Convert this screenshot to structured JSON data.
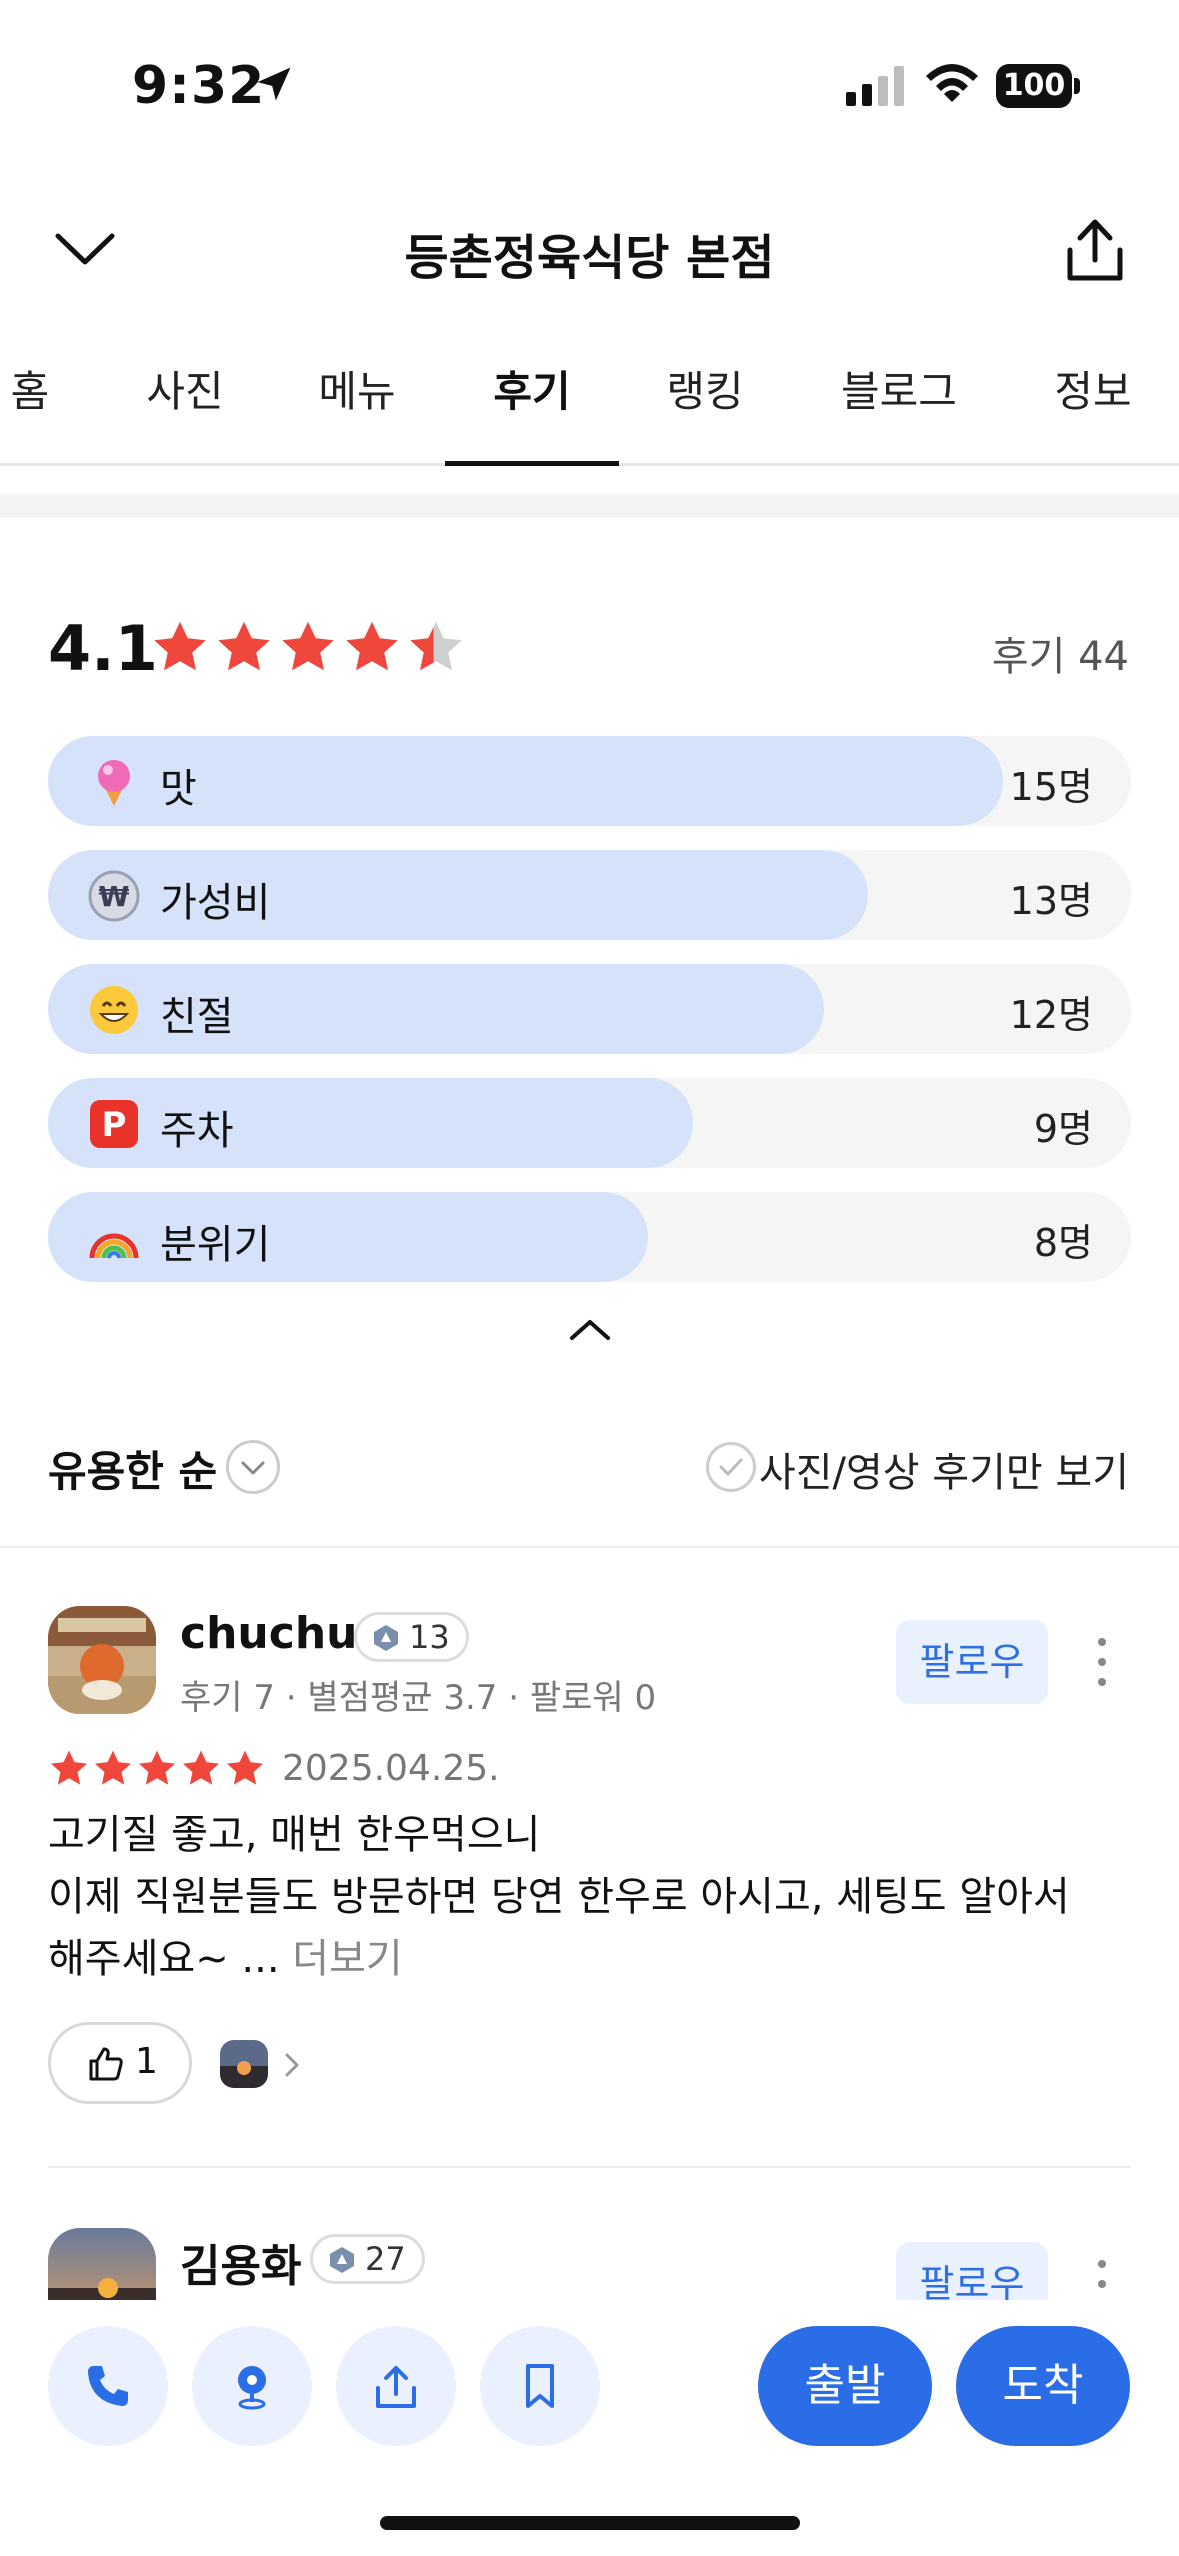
{
  "status_bar": {
    "time": "9:32",
    "battery": "100"
  },
  "header": {
    "title": "등촌정육식당 본점"
  },
  "tabs": [
    {
      "label": "홈"
    },
    {
      "label": "사진"
    },
    {
      "label": "메뉴"
    },
    {
      "label": "후기",
      "active": true
    },
    {
      "label": "랭킹"
    },
    {
      "label": "블로그"
    },
    {
      "label": "정보"
    }
  ],
  "rating": {
    "score": "4.1",
    "review_count": "후기 44"
  },
  "keywords": [
    {
      "emoji": "ice-cream-icon",
      "label": "맛",
      "count": "15명",
      "fill_fraction": 0.84
    },
    {
      "emoji": "won-coin-icon",
      "label": "가성비",
      "count": "13명",
      "fill_fraction": 0.76
    },
    {
      "emoji": "smile-icon",
      "label": "친절",
      "count": "12명",
      "fill_fraction": 0.72
    },
    {
      "emoji": "parking-icon",
      "label": "주차",
      "count": "9명",
      "fill_fraction": 0.6
    },
    {
      "emoji": "rainbow-icon",
      "label": "분위기",
      "count": "8명",
      "fill_fraction": 0.56
    }
  ],
  "sort": {
    "label": "유용한 순",
    "filter_label": "사진/영상 후기만 보기"
  },
  "reviews": [
    {
      "name": "chuchu",
      "level": "13",
      "meta": "후기 7 · 별점평균 3.7 · 팔로워 0",
      "follow_label": "팔로우",
      "date": "2025.04.25.",
      "rating": 5,
      "text_line1": "고기질 좋고, 매번 한우먹으니",
      "text_line2": "이제 직원분들도 방문하면 당연 한우로 아시고, 세팅도 알아서",
      "text_line3": "해주세요~ ...",
      "more_label": "더보기",
      "likes": "1"
    },
    {
      "name": "김용화",
      "level": "27",
      "follow_label": "팔로우"
    }
  ],
  "bottom_bar": {
    "depart_label": "출발",
    "arrive_label": "도착"
  },
  "colors": {
    "accent": "#2a6de6",
    "star": "#f0463c",
    "bar_fill": "#d5e2fa"
  }
}
